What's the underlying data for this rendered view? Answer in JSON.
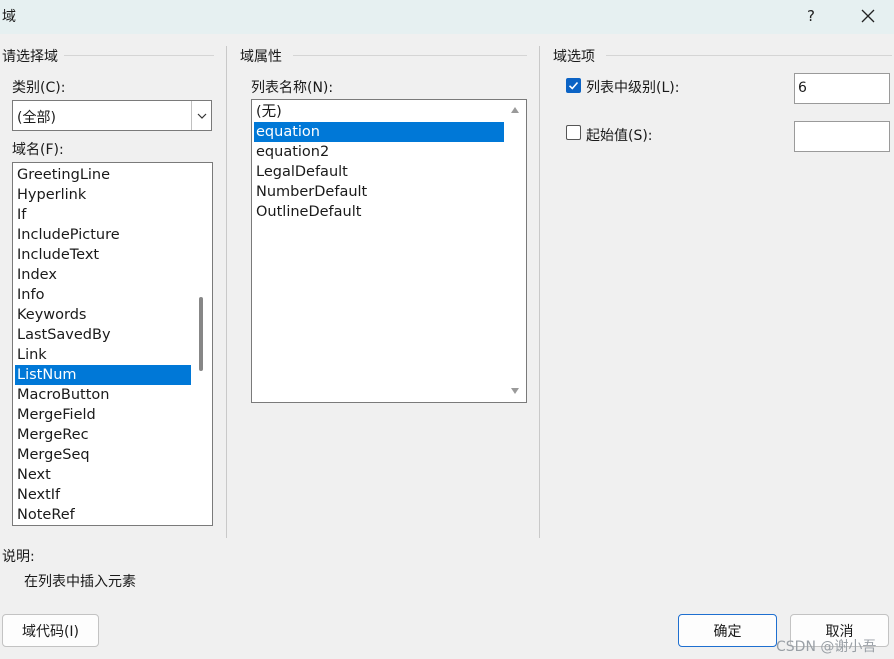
{
  "window": {
    "title": "域",
    "help_label": "?",
    "close_label": "✕"
  },
  "left": {
    "section_title": "请选择域",
    "category_label": "类别(C):",
    "category_value": "(全部)",
    "fieldname_label": "域名(F):",
    "fields": [
      "GreetingLine",
      "Hyperlink",
      "If",
      "IncludePicture",
      "IncludeText",
      "Index",
      "Info",
      "Keywords",
      "LastSavedBy",
      "Link",
      "ListNum",
      "MacroButton",
      "MergeField",
      "MergeRec",
      "MergeSeq",
      "Next",
      "NextIf",
      "NoteRef"
    ],
    "selected_field": "ListNum"
  },
  "middle": {
    "section_title": "域属性",
    "listname_label": "列表名称(N):",
    "list_names": [
      "(无)",
      "equation",
      "equation2",
      "LegalDefault",
      "NumberDefault",
      "OutlineDefault"
    ],
    "selected_list": "equation"
  },
  "right": {
    "section_title": "域选项",
    "level_label": "列表中级别(L):",
    "level_checked": true,
    "level_value": "6",
    "start_label": "起始值(S):",
    "start_checked": false,
    "start_value": ""
  },
  "description": {
    "title": "说明:",
    "text": "在列表中插入元素"
  },
  "buttons": {
    "field_codes": "域代码(I)",
    "ok": "确定",
    "cancel": "取消"
  },
  "watermark": "CSDN @谢小吾"
}
